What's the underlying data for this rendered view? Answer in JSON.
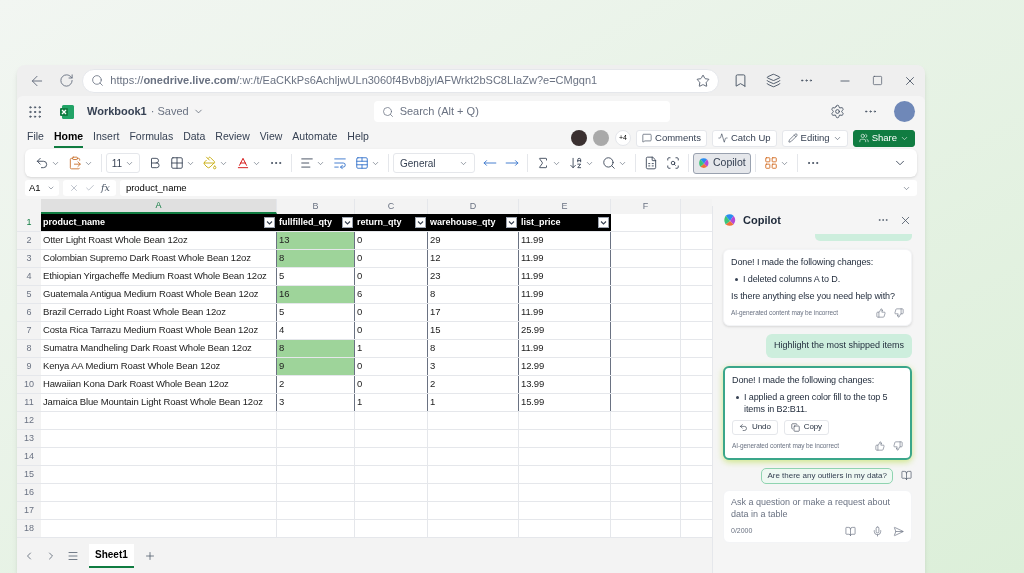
{
  "browser": {
    "url": "https://**onedrive.live.com**/:w:/t/EaCKkPs6AchljwULn3060f4Bvb8jylAFWrkt2bSC8LIaZw?e=CMgqn1"
  },
  "app_header": {
    "title": "Workbook1",
    "status": "· Saved",
    "search": {
      "placeholder": "Search (Alt + Q)"
    }
  },
  "tabs": [
    {
      "label": "File",
      "selected": false
    },
    {
      "label": "Home",
      "selected": true
    },
    {
      "label": "Insert",
      "selected": false
    },
    {
      "label": "Formulas",
      "selected": false
    },
    {
      "label": "Data",
      "selected": false
    },
    {
      "label": "Review",
      "selected": false
    },
    {
      "label": "View",
      "selected": false
    },
    {
      "label": "Automate",
      "selected": false
    },
    {
      "label": "Help",
      "selected": false
    }
  ],
  "collaboration": {
    "more_count": "+4",
    "buttons": [
      {
        "kind": "comments",
        "label": "Comments"
      },
      {
        "kind": "catchup",
        "label": "Catch Up"
      },
      {
        "kind": "editing",
        "label": "Editing"
      },
      {
        "kind": "share",
        "label": "Share"
      }
    ]
  },
  "ribbon": {
    "font_size": "11",
    "number_format": "General",
    "copilot": {
      "label": "Copilot",
      "selected": true
    }
  },
  "formula_bar": {
    "name_box": "A1",
    "function_label": "fx",
    "formula": "product_name"
  },
  "table": {
    "column_letters": [
      "A",
      "B",
      "C",
      "D",
      "E",
      "F"
    ],
    "row_numbers": [
      "1",
      "2",
      "3",
      "4",
      "5",
      "6",
      "7",
      "8",
      "9",
      "10",
      "11",
      "12",
      "13",
      "14",
      "15",
      "16",
      "17",
      "18"
    ],
    "headers": [
      "product_name",
      "fullfilled_qty",
      "return_qty",
      "warehouse_qty",
      "list_price"
    ],
    "rows": [
      [
        {
          "text": "Otter Light Roast Whole Bean 12oz",
          "highlighted": false
        },
        {
          "text": "13",
          "highlighted": true
        },
        {
          "text": "0",
          "highlighted": false
        },
        {
          "text": "29",
          "highlighted": false
        },
        {
          "text": "11.99",
          "highlighted": false
        }
      ],
      [
        {
          "text": "Colombian Supremo Dark Roast Whole Bean 12oz",
          "highlighted": false
        },
        {
          "text": "8",
          "highlighted": true
        },
        {
          "text": "0",
          "highlighted": false
        },
        {
          "text": "12",
          "highlighted": false
        },
        {
          "text": "11.99",
          "highlighted": false
        }
      ],
      [
        {
          "text": "Ethiopian Yirgacheffe Medium Roast Whole Bean 12oz",
          "highlighted": false
        },
        {
          "text": "5",
          "highlighted": false
        },
        {
          "text": "0",
          "highlighted": false
        },
        {
          "text": "23",
          "highlighted": false
        },
        {
          "text": "11.99",
          "highlighted": false
        }
      ],
      [
        {
          "text": "Guatemala Antigua Medium Roast Whole Bean 12oz",
          "highlighted": false
        },
        {
          "text": "16",
          "highlighted": true
        },
        {
          "text": "6",
          "highlighted": false
        },
        {
          "text": "8",
          "highlighted": false
        },
        {
          "text": "11.99",
          "highlighted": false
        }
      ],
      [
        {
          "text": "Brazil Cerrado Light Roast Whole Bean 12oz",
          "highlighted": false
        },
        {
          "text": "5",
          "highlighted": false
        },
        {
          "text": "0",
          "highlighted": false
        },
        {
          "text": "17",
          "highlighted": false
        },
        {
          "text": "11.99",
          "highlighted": false
        }
      ],
      [
        {
          "text": "Costa Rica Tarrazu Medium Roast Whole Bean 12oz",
          "highlighted": false
        },
        {
          "text": "4",
          "highlighted": false
        },
        {
          "text": "0",
          "highlighted": false
        },
        {
          "text": "15",
          "highlighted": false
        },
        {
          "text": "25.99",
          "highlighted": false
        }
      ],
      [
        {
          "text": "Sumatra Mandheling Dark Roast Whole Bean 12oz",
          "highlighted": false
        },
        {
          "text": "8",
          "highlighted": true
        },
        {
          "text": "1",
          "highlighted": false
        },
        {
          "text": "8",
          "highlighted": false
        },
        {
          "text": "11.99",
          "highlighted": false
        }
      ],
      [
        {
          "text": "Kenya AA Medium Roast Whole Bean 12oz",
          "highlighted": false
        },
        {
          "text": "9",
          "highlighted": true
        },
        {
          "text": "0",
          "highlighted": false
        },
        {
          "text": "3",
          "highlighted": false
        },
        {
          "text": "12.99",
          "highlighted": false
        }
      ],
      [
        {
          "text": "Hawaiian Kona Dark Roast Whole Bean 12oz",
          "highlighted": false
        },
        {
          "text": "2",
          "highlighted": false
        },
        {
          "text": "0",
          "highlighted": false
        },
        {
          "text": "2",
          "highlighted": false
        },
        {
          "text": "13.99",
          "highlighted": false
        }
      ],
      [
        {
          "text": "Jamaica Blue Mountain Light Roast Whole Bean 12oz",
          "highlighted": false
        },
        {
          "text": "3",
          "highlighted": false
        },
        {
          "text": "1",
          "highlighted": false
        },
        {
          "text": "1",
          "highlighted": false
        },
        {
          "text": "15.99",
          "highlighted": false
        }
      ]
    ]
  },
  "sheet_tabs": [
    {
      "label": "Sheet1",
      "selected": true
    }
  ],
  "copilot": {
    "title": "Copilot",
    "messages": [
      {
        "kind": "assistant",
        "focused": false,
        "intro": "Done! I made the following changes:",
        "bullets": [
          "I deleted columns A to D."
        ],
        "outro": "Is there anything else you need help with?",
        "disclaimer": "AI-generated content may be incorrect"
      },
      {
        "kind": "user",
        "text": "Highlight the most shipped items"
      },
      {
        "kind": "assistant",
        "focused": true,
        "intro": "Done! I made the following changes:",
        "bullets": [
          "I applied a green color fill to the top 5 items in B2:B11."
        ],
        "actions": [
          {
            "kind": "undo",
            "label": "Undo"
          },
          {
            "kind": "copy",
            "label": "Copy"
          }
        ],
        "disclaimer": "AI-generated content may be incorrect"
      }
    ],
    "suggestion": "Are there any outliers in my data?",
    "input": {
      "placeholder": "Ask a question or make a request about data in a table",
      "counter": "0/2000"
    }
  }
}
